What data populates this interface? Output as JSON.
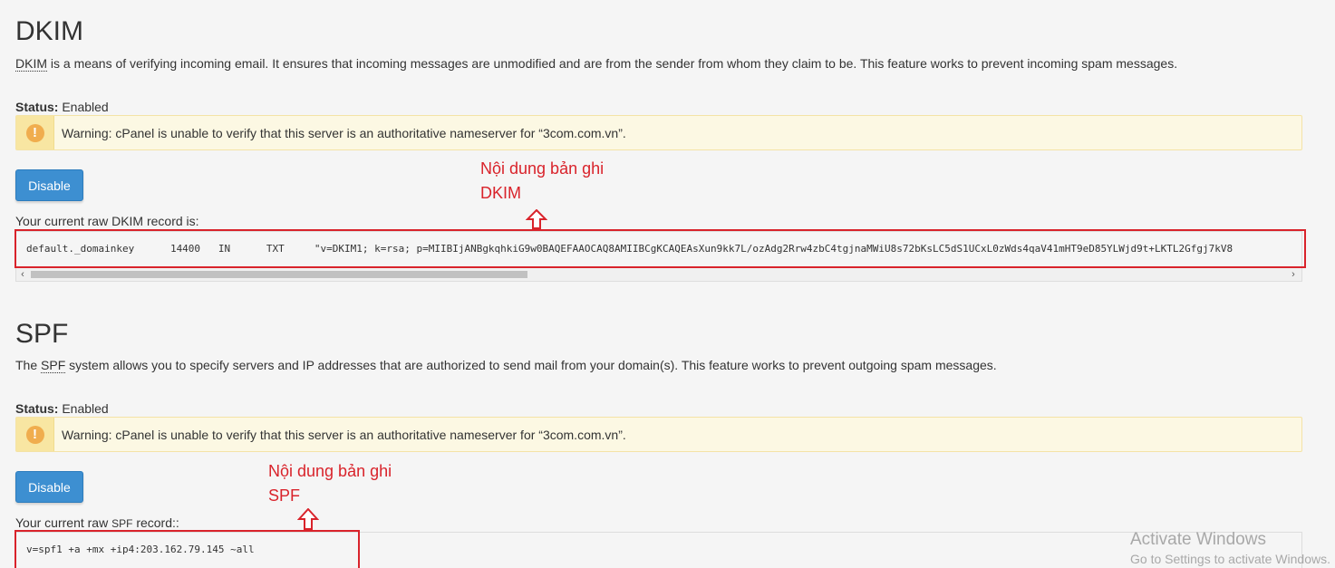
{
  "dkim": {
    "title": "DKIM",
    "desc_abbr": "DKIM",
    "desc_rest": " is a means of verifying incoming email. It ensures that incoming messages are unmodified and are from the sender from whom they claim to be. This feature works to prevent incoming spam messages.",
    "status_label": "Status:",
    "status_value": " Enabled",
    "warning_icon": "exclamation-icon",
    "warning_text": "Warning: cPanel is unable to verify that this server is an authoritative nameserver for “3com.com.vn”.",
    "button_label": "Disable",
    "raw_label": "Your current raw DKIM record is:",
    "record": "default._domainkey      14400   IN      TXT     \"v=DKIM1; k=rsa; p=MIIBIjANBgkqhkiG9w0BAQEFAAOCAQ8AMIIBCgKCAQEAsXun9kk7L/ozAdg2Rrw4zbC4tgjnaMWiU8s72bKsLC5dS1UCxL0zWds4qaV41mHT9eD85YLWjd9t+LKTL2Gfgj7kV8",
    "annotation_line1": "Nội dung bản ghi",
    "annotation_line2": "DKIM"
  },
  "spf": {
    "title": "SPF",
    "desc_pre": "The ",
    "desc_abbr": "SPF",
    "desc_rest": " system allows you to specify servers and IP addresses that are authorized to send mail from your domain(s). This feature works to prevent outgoing spam messages.",
    "status_label": "Status:",
    "status_value": " Enabled",
    "warning_icon": "exclamation-icon",
    "warning_text": "Warning: cPanel is unable to verify that this server is an authoritative nameserver for “3com.com.vn”.",
    "button_label": "Disable",
    "raw_label_pre": "Your current raw ",
    "raw_label_abbr": "SPF",
    "raw_label_post": " record::",
    "record": "v=spf1 +a +mx +ip4:203.162.79.145 ~all",
    "annotation_line1": "Nội dung bản ghi",
    "annotation_line2": "SPF"
  },
  "scrollbar": {
    "left_arrow": "‹",
    "right_arrow": "›"
  },
  "watermark": {
    "line1": "Activate Windows",
    "line2": "Go to Settings to activate Windows."
  },
  "colors": {
    "annotation_red": "#d9232b",
    "button_blue": "#3d8fd1",
    "warning_bg": "#fcf8e3",
    "warning_icon": "#f0ad4e"
  }
}
